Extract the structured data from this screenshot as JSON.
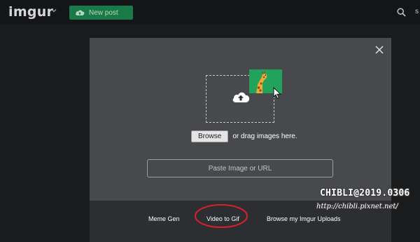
{
  "header": {
    "logo": "imgur",
    "new_post_label": "New post",
    "right_letter": "s"
  },
  "icons": {
    "logo_chevron": "chevron-down-icon",
    "new_post": "upload-cloud-icon",
    "search": "search-icon",
    "close": "close-icon",
    "upload": "cloud-upload-icon",
    "giraffe": "giraffe-icon",
    "cursor": "mouse-pointer-icon"
  },
  "modal": {
    "browse_label": "Browse",
    "drag_text": "or drag images here.",
    "url_placeholder": "Paste Image or URL",
    "footer_links": [
      "Meme Gen",
      "Video to Gif",
      "Browse my Imgur Uploads"
    ]
  },
  "annotation": {
    "highlighted": "Video to Gif",
    "color": "#d8212a"
  },
  "watermark": {
    "title": "CHIBLI@2019.0306",
    "url": "http://chibli.pixnet.net/"
  },
  "colors": {
    "new_post_bg": "#1a7a47",
    "image_card": "#22a35b",
    "modal_bg": "#47494d",
    "footer_bg": "#2c2e31"
  }
}
